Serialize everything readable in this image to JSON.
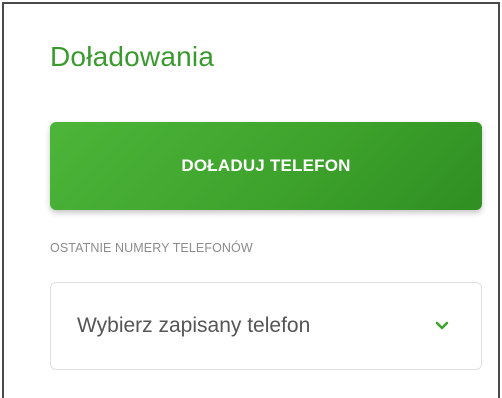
{
  "section": {
    "title": "Doładowania"
  },
  "topup": {
    "button_label": "DOŁADUJ TELEFON",
    "accent_color": "#3ea32c"
  },
  "recent_numbers": {
    "label": "OSTATNIE NUMERY TELEFONÓW",
    "select_value": "Wybierz zapisany telefon",
    "chevron_icon": "chevron-down-icon"
  }
}
